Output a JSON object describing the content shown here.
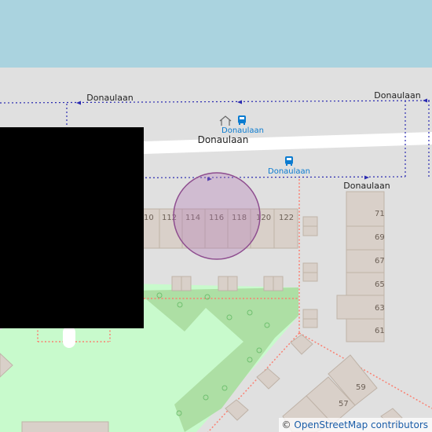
{
  "map": {
    "colors": {
      "water": "#aad3df",
      "land": "#e0e0e0",
      "road": "#ffffff",
      "park": "#c8facc",
      "grass": "#addfa4",
      "building": "#d9d0c9",
      "building_stroke": "#bfb3a8",
      "marker": "#b277b4",
      "footway": "#fa8072",
      "boundary": "#2a2ab0",
      "label": "#222222",
      "transit": "#0a7bd0"
    },
    "street_labels": [
      "Donaulaan",
      "Donaulaan",
      "Donaulaan",
      "Donaulaan"
    ],
    "transit_stops": [
      {
        "name": "Donaulaan",
        "icon": "bus-icon"
      },
      {
        "name": "Donaulaan",
        "icon": "bus-icon"
      }
    ],
    "poi_icon": "shelter-icon",
    "house_numbers_row": [
      "10",
      "112",
      "114",
      "116",
      "118",
      "120",
      "122"
    ],
    "house_numbers_column": [
      "71",
      "69",
      "67",
      "65",
      "63",
      "61"
    ],
    "house_numbers_lower": [
      "59",
      "57"
    ],
    "attribution": {
      "symbol": "©",
      "text": "OpenStreetMap contributors"
    }
  }
}
